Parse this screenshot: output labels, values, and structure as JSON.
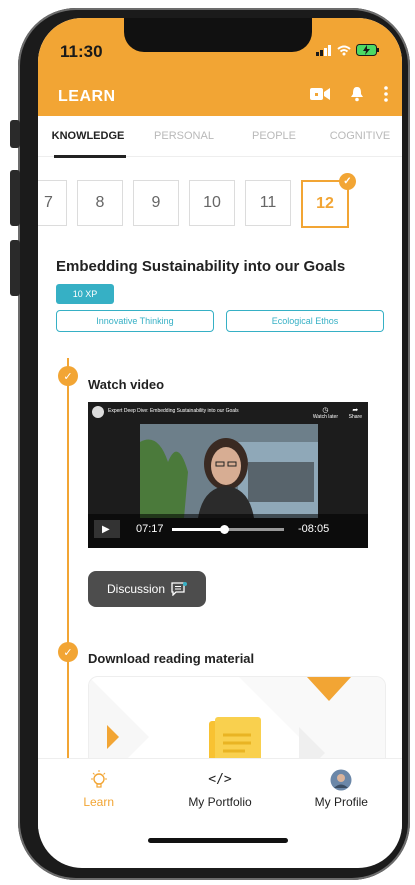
{
  "status_bar": {
    "time": "11:30"
  },
  "header": {
    "title": "LEARN"
  },
  "tabs": [
    {
      "label": "KNOWLEDGE",
      "active": true
    },
    {
      "label": "PERSONAL",
      "active": false
    },
    {
      "label": "PEOPLE",
      "active": false
    },
    {
      "label": "COGNITIVE",
      "active": false
    }
  ],
  "lesson_numbers": [
    "7",
    "8",
    "9",
    "10",
    "11",
    "12"
  ],
  "selected_number": "12",
  "lesson": {
    "title": "Embedding Sustainability into our Goals",
    "xp": "10 XP",
    "skills": [
      "Innovative Thinking",
      "Ecological Ethos"
    ]
  },
  "steps": [
    {
      "title": "Watch video"
    },
    {
      "title": "Download reading material"
    }
  ],
  "video": {
    "title": "Expert Deep Dive: Embedding Sustainability into our Goals",
    "elapsed": "07:17",
    "remaining": "-08:05",
    "watch_later": "Watch later",
    "share": "Share",
    "progress": 0.47
  },
  "discussion": {
    "label": "Discussion"
  },
  "bottom_nav": [
    {
      "label": "Learn",
      "icon": "lightbulb-icon",
      "active": true
    },
    {
      "label": "My Portfolio",
      "icon": "code-icon",
      "active": false
    },
    {
      "label": "My Profile",
      "icon": "avatar",
      "active": false
    }
  ],
  "colors": {
    "accent": "#f2a534",
    "teal": "#36b0c5"
  }
}
